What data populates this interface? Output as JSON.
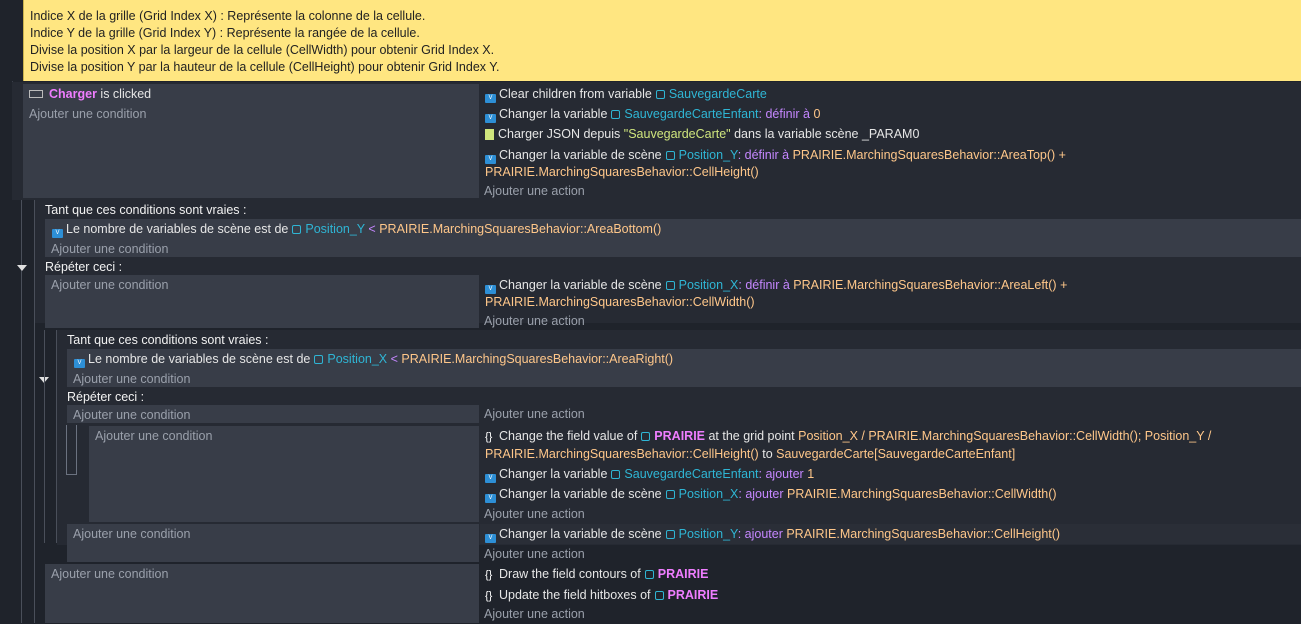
{
  "comment": {
    "lines": [
      "Indice X de la grille (Grid Index X) : Représente la colonne de la cellule.",
      "Indice Y de la grille (Grid Index Y) : Représente la rangée de la cellule.",
      "Divise la position X par la largeur de la cellule (CellWidth) pour obtenir Grid Index X.",
      "Divise la position Y par la hauteur de la cellule (CellHeight) pour obtenir Grid Index Y."
    ]
  },
  "add_condition": "Ajouter une condition",
  "add_action": "Ajouter une action",
  "while_header": "Tant que ces conditions sont vraies :",
  "repeat_header": "Répéter ceci :",
  "e1": {
    "obj": "Charger",
    "clicked": "is clicked",
    "a1": "Clear children from variable",
    "v1": "SauvegardeCarte",
    "a2": "Changer la variable",
    "v2": "SauvegardeCarteEnfant",
    "a2op": ": définir à",
    "a2val": "0",
    "a3": "Charger JSON depuis",
    "a3str": "\"SauvegardeCarte\"",
    "a3b": "dans la variable scène _PARAM0",
    "a4": "Changer la variable de scène",
    "v4": "Position_Y",
    "a4op": ": définir à",
    "a4expr1": "PRAIRIE.MarchingSquaresBehavior::AreaTop() +",
    "a4expr2": "PRAIRIE.MarchingSquaresBehavior::CellHeight()"
  },
  "w1": {
    "c1": "Le nombre de variables de scène est de",
    "v": "Position_Y",
    "op": "<",
    "expr": "PRAIRIE.MarchingSquaresBehavior::AreaBottom()",
    "a1": "Changer la variable de scène",
    "av": "Position_X",
    "aop": ": définir à",
    "aexpr1": "PRAIRIE.MarchingSquaresBehavior::AreaLeft() +",
    "aexpr2": "PRAIRIE.MarchingSquaresBehavior::CellWidth()"
  },
  "w2": {
    "c1": "Le nombre de variables de scène est de",
    "v": "Position_X",
    "op": "<",
    "expr": "PRAIRIE.MarchingSquaresBehavior::AreaRight()"
  },
  "e3": {
    "a1": "Change the field value of",
    "obj": "PRAIRIE",
    "a1b": "at the grid point",
    "a1expr": "Position_X / PRAIRIE.MarchingSquaresBehavior::CellWidth(); Position_Y /",
    "a1expr2": "PRAIRIE.MarchingSquaresBehavior::CellHeight()",
    "a1to": "to",
    "a1val": "SauvegardeCarte[SauvegardeCarteEnfant]",
    "a2": "Changer la variable",
    "v2": "SauvegardeCarteEnfant",
    "a2op": ": ajouter",
    "a2val": "1",
    "a3": "Changer la variable de scène",
    "v3": "Position_X",
    "a3op": ": ajouter",
    "a3expr": "PRAIRIE.MarchingSquaresBehavior::CellWidth()"
  },
  "e4": {
    "a1": "Changer la variable de scène",
    "v1": "Position_Y",
    "a1op": ": ajouter",
    "a1expr": "PRAIRIE.MarchingSquaresBehavior::CellHeight()"
  },
  "e5": {
    "a1": "Draw the field contours of",
    "obj": "PRAIRIE",
    "a2": "Update the field hitboxes of",
    "obj2": "PRAIRIE"
  }
}
